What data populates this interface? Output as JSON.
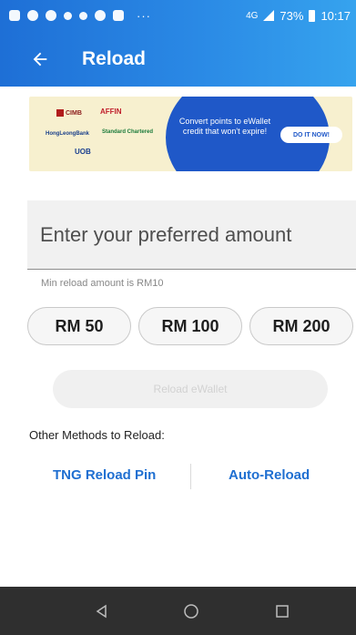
{
  "status_bar": {
    "network": "4G",
    "battery": "73%",
    "time": "10:17",
    "overflow": "···"
  },
  "app_bar": {
    "title": "Reload",
    "back_icon": "arrow-left-icon"
  },
  "banner": {
    "logos": [
      "CIMB",
      "AFFIN",
      "HongLeongBank",
      "Standard Chartered",
      "UOB"
    ],
    "tagline": "Convert points to eWallet credit that won't expire!",
    "cta": "DO IT NOW!"
  },
  "amount": {
    "placeholder": "Enter your preferred amount",
    "value": "",
    "hint": "Min reload amount is RM10"
  },
  "presets": [
    "RM 50",
    "RM 100",
    "RM 200"
  ],
  "reload_button": "Reload eWallet",
  "other_methods": {
    "label": "Other Methods to Reload:",
    "options": [
      "TNG Reload Pin",
      "Auto-Reload"
    ]
  },
  "colors": {
    "brand_blue": "#1f6fd1",
    "appbar_gradient_start": "#1e6fd6",
    "appbar_gradient_end": "#36a3ee",
    "banner_background": "#f7f0cf"
  }
}
